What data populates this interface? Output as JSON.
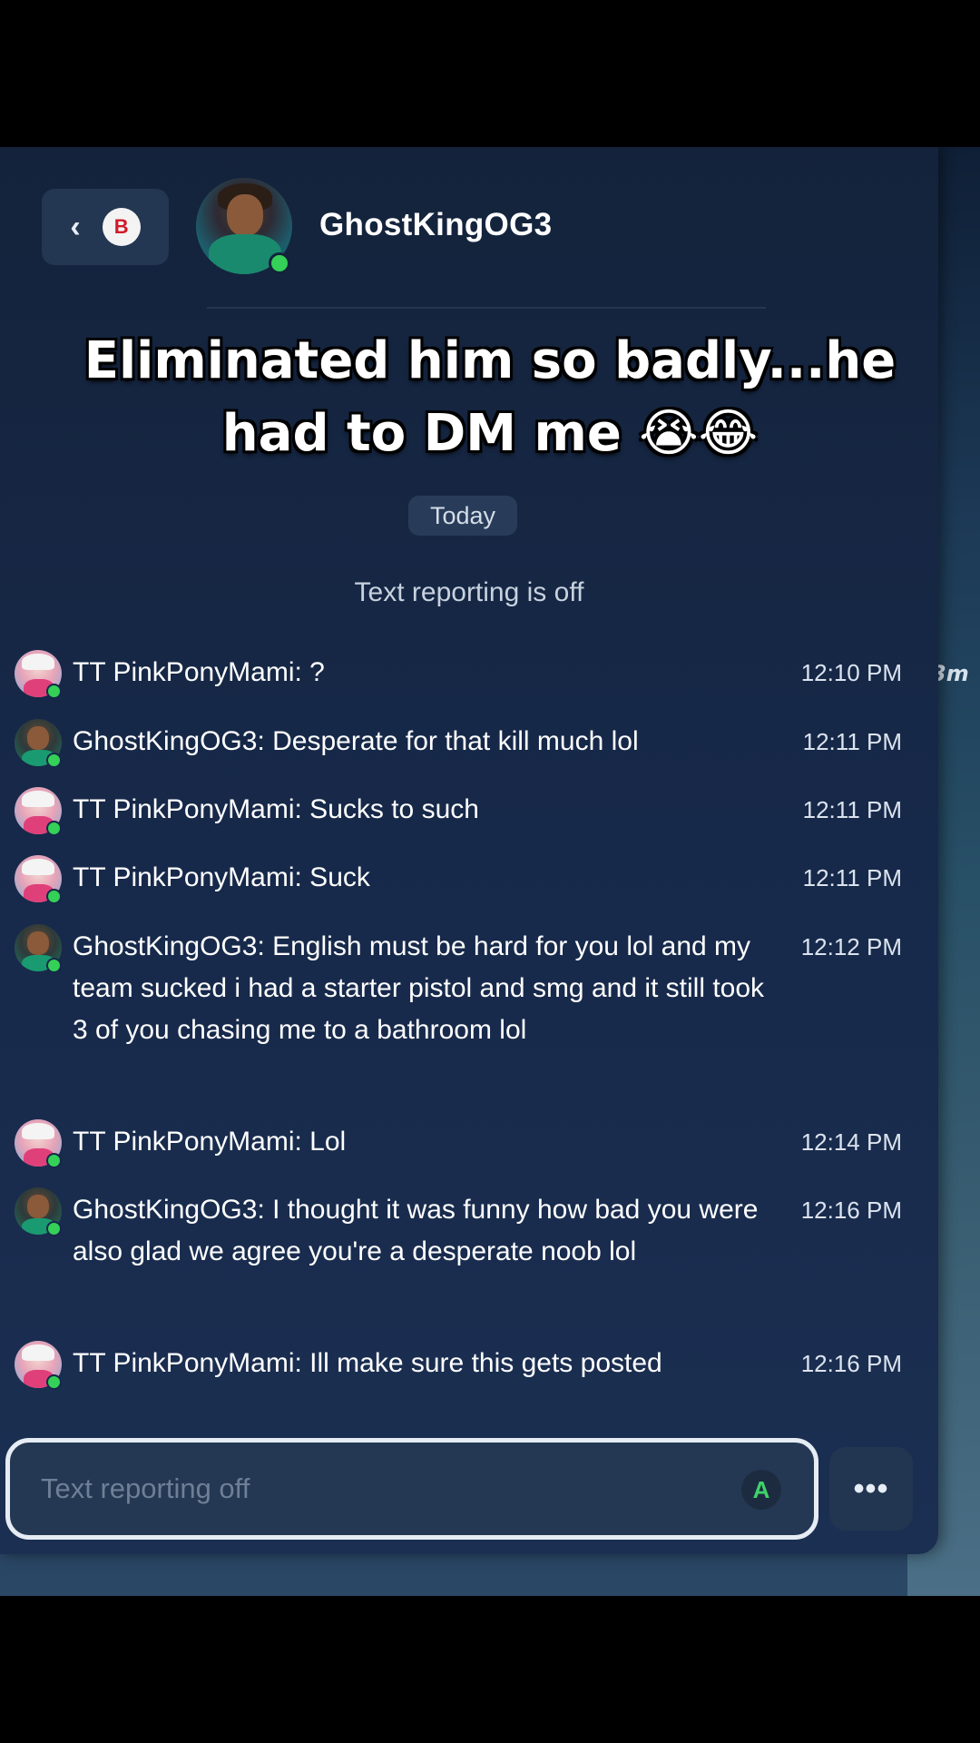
{
  "caption": {
    "line1": "Eliminated him so badly...he",
    "line2": "had to DM me 😭😂"
  },
  "header": {
    "back_icon": "chevron-left-icon",
    "controller_button": "B",
    "name": "GhostKingOG3"
  },
  "date_separator": "Today",
  "notice": "Text reporting is off",
  "messages": [
    {
      "author": "pink",
      "text": "TT PinkPonyMami: ?",
      "time": "12:10 PM"
    },
    {
      "author": "ghost",
      "text": "GhostKingOG3: Desperate for that kill much lol",
      "time": "12:11 PM"
    },
    {
      "author": "pink",
      "text": "TT PinkPonyMami: Sucks to such",
      "time": "12:11 PM"
    },
    {
      "author": "pink",
      "text": "TT PinkPonyMami: Suck",
      "time": "12:11 PM"
    },
    {
      "author": "ghost",
      "text": "GhostKingOG3: English must be hard for you lol and my team sucked i had a starter pistol and smg and it still took 3 of you chasing me to a bathroom lol",
      "time": "12:12 PM"
    },
    {
      "author": "pink",
      "text": "TT PinkPonyMami: Lol",
      "time": "12:14 PM"
    },
    {
      "author": "ghost",
      "text": "GhostKingOG3: I thought it was funny how bad you were also glad we agree you're a desperate noob lol",
      "time": "12:16 PM"
    },
    {
      "author": "pink",
      "text": "TT PinkPonyMami: Ill make sure this gets posted",
      "time": "12:16 PM"
    }
  ],
  "input": {
    "placeholder": "Text reporting off",
    "controller_button": "A"
  },
  "more_button": "•••",
  "game_marker": "3m"
}
